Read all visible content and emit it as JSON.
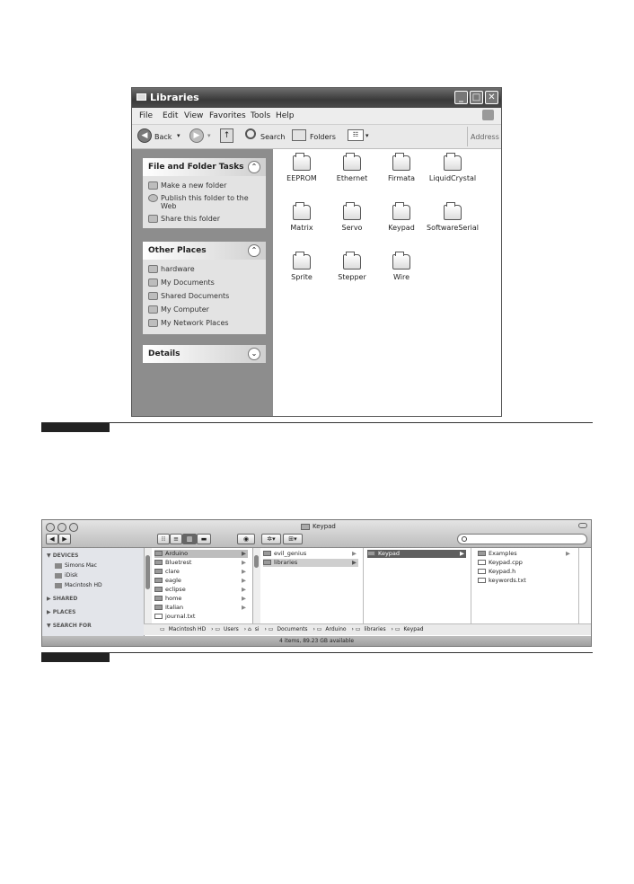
{
  "xp": {
    "title": "Libraries",
    "menu": [
      "File",
      "Edit",
      "View",
      "Favorites",
      "Tools",
      "Help"
    ],
    "toolbar": {
      "back": "Back",
      "search": "Search",
      "folders": "Folders",
      "address": "Address"
    },
    "tasks": {
      "header": "File and Folder Tasks",
      "items": [
        "Make a new folder",
        "Publish this folder to the Web",
        "Share this folder"
      ]
    },
    "places": {
      "header": "Other Places",
      "items": [
        "hardware",
        "My Documents",
        "Shared Documents",
        "My Computer",
        "My Network Places"
      ]
    },
    "details": {
      "header": "Details"
    },
    "folders": [
      "EEPROM",
      "Ethernet",
      "Firmata",
      "LiquidCrystal",
      "Matrix",
      "Servo",
      "Keypad",
      "SoftwareSerial",
      "Sprite",
      "Stepper",
      "Wire"
    ]
  },
  "mac": {
    "title": "Keypad",
    "search_placeholder": "",
    "sidebar": {
      "devices_header": "DEVICES",
      "devices": [
        "Simons Mac",
        "iDisk",
        "Macintosh HD"
      ],
      "shared_header": "SHARED",
      "places_header": "PLACES",
      "search_header": "SEARCH FOR"
    },
    "col1": [
      "Arduino",
      "Bluetrest",
      "clare",
      "eagle",
      "eclipse",
      "home",
      "Italian",
      "journal.txt"
    ],
    "col2": [
      "evil_genius",
      "libraries"
    ],
    "col3": [
      "Keypad"
    ],
    "col4": [
      "Examples",
      "Keypad.cpp",
      "Keypad.h",
      "keywords.txt"
    ],
    "path": [
      "Macintosh HD",
      "Users",
      "si",
      "Documents",
      "Arduino",
      "libraries",
      "Keypad"
    ],
    "status": "4 items, 89.23 GB available"
  }
}
